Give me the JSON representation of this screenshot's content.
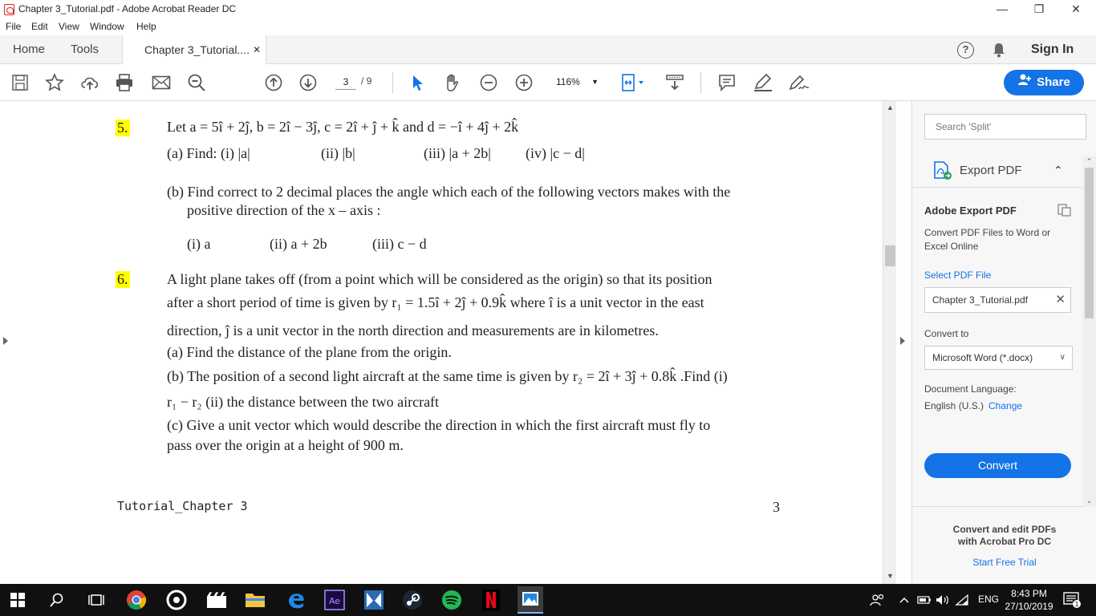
{
  "window": {
    "title": "Chapter 3_Tutorial.pdf - Adobe Acrobat Reader DC",
    "minimize": "—",
    "restore": "❐",
    "close": "✕"
  },
  "menu": [
    "File",
    "Edit",
    "View",
    "Window",
    "Help"
  ],
  "tabs": {
    "home": "Home",
    "tools": "Tools",
    "doc": "Chapter 3_Tutorial....",
    "doc_close": "✕",
    "sign_in": "Sign In"
  },
  "toolbar": {
    "page_current": "3",
    "page_total": "/ 9",
    "zoom": "116%",
    "share": "Share"
  },
  "document": {
    "q5": {
      "num": "5.",
      "line1": "Let a = 5î + 2ĵ,   b = 2î − 3ĵ,   c = 2î + ĵ + k̂  and  d = −î + 4ĵ + 2k̂",
      "line2a": "(a) Find: (i) |a|",
      "line2b": "(ii) |b|",
      "line2c": "(iii) |a + 2b|",
      "line2d": "(iv) |c − d|",
      "line3": "(b) Find correct to 2 decimal places the angle which each of the following vectors makes with the",
      "line4": "positive direction of the x – axis :",
      "line5a": "(i) a",
      "line5b": "(ii) a + 2b",
      "line5c": "(iii) c − d"
    },
    "q6": {
      "num": "6.",
      "line1": "A light plane takes off (from a point which will be considered as the origin) so that its position",
      "line2": "after a short period of time is given by r₁ = 1.5î + 2ĵ + 0.9k̂  where  î  is a unit vector in the east",
      "line3": "direction,  ĵ  is a unit vector in the north direction and measurements are in kilometres.",
      "line4": "(a) Find the distance of the plane from the origin.",
      "line5": "(b) The position of a second light aircraft at the same time is given by r₂ = 2î + 3ĵ + 0.8k̂ .Find (i)",
      "line6": "r₁ − r₂  (ii) the distance between the two aircraft",
      "line7": "(c) Give a unit vector which would describe the direction in which the first aircraft must fly to",
      "line8": "pass over the origin at a height of 900 m."
    },
    "footer_left": "Tutorial_Chapter 3",
    "footer_right": "3"
  },
  "panel": {
    "search_placeholder": "Search 'Split'",
    "export_title": "Export PDF",
    "heading": "Adobe Export PDF",
    "desc": "Convert PDF Files to Word or Excel Online",
    "select_link": "Select PDF File",
    "file_name": "Chapter 3_Tutorial.pdf",
    "convert_to_label": "Convert to",
    "convert_to_value": "Microsoft Word (*.docx)",
    "doc_lang_label": "Document Language:",
    "doc_lang_value": "English (U.S.)",
    "change_link": "Change",
    "convert_button": "Convert",
    "promo": "Convert and edit PDFs with Acrobat Pro DC",
    "trial_link": "Start Free Trial"
  },
  "taskbar": {
    "lang": "ENG",
    "time": "8:43 PM",
    "date": "27/10/2019",
    "notif_count": "1"
  },
  "colors": {
    "accent": "#1473e6",
    "highlight": "#ffff00",
    "taskbar": "#101010"
  }
}
